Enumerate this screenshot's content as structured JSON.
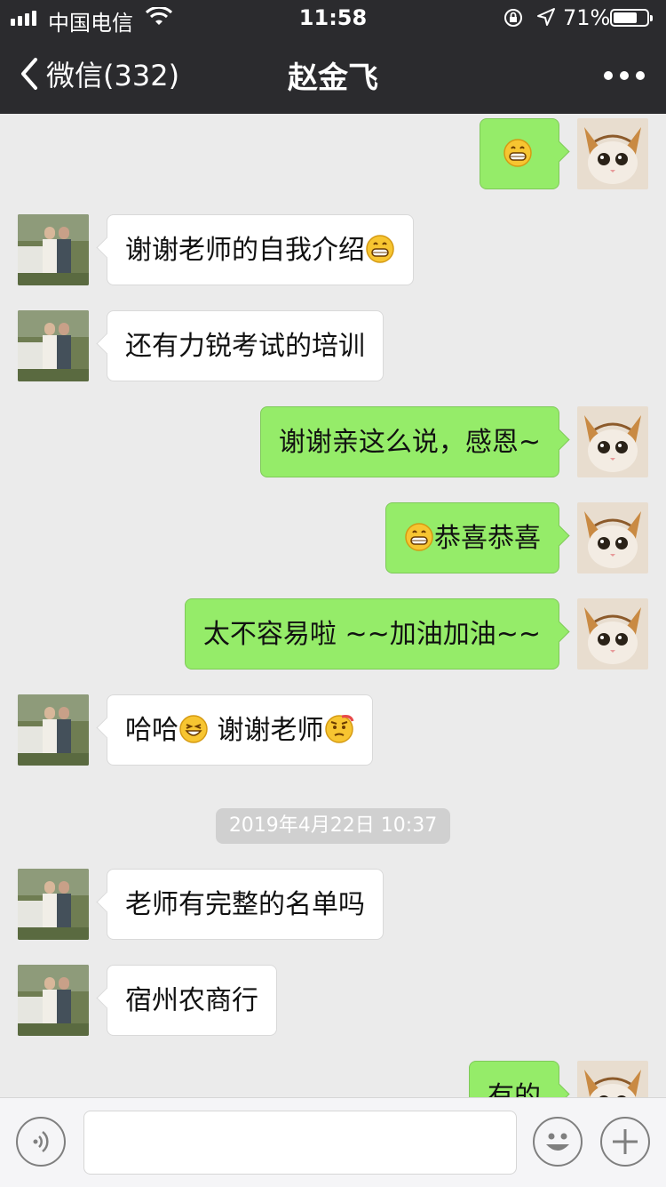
{
  "status_bar": {
    "carrier": "中国电信",
    "time": "11:58",
    "battery_percent": "71%",
    "battery_level": 0.71
  },
  "nav": {
    "back_label": "微信(332)",
    "title": "赵金飞"
  },
  "messages": [
    {
      "dir": "out",
      "text": "",
      "emoji_before": "grin-emoji"
    },
    {
      "dir": "in",
      "text": "谢谢老师的自我介绍",
      "emoji_after": "grin-emoji"
    },
    {
      "dir": "in",
      "text": "还有力锐考试的培训"
    },
    {
      "dir": "out",
      "text": "谢谢亲这么说，感恩~"
    },
    {
      "dir": "out",
      "text": "恭喜恭喜",
      "emoji_before": "grin-emoji"
    },
    {
      "dir": "out",
      "text": "太不容易啦 ~~加油加油~~"
    },
    {
      "dir": "in",
      "text_a": "哈哈",
      "text_b": " 谢谢老师"
    },
    {
      "timestamp": "2019年4月22日 10:37"
    },
    {
      "dir": "in",
      "text": "老师有完整的名单吗"
    },
    {
      "dir": "in",
      "text": "宿州农商行"
    },
    {
      "dir": "out",
      "text": "有的"
    }
  ],
  "colors": {
    "nav_bg": "#2b2b2e",
    "chat_bg": "#ebebeb",
    "outgoing_bubble": "#95ec69",
    "incoming_bubble": "#ffffff"
  },
  "icons": {
    "back": "chevron-left-icon",
    "more": "more-dots-icon",
    "voice": "voice-icon",
    "emoji": "smiley-icon",
    "plus": "plus-icon"
  }
}
